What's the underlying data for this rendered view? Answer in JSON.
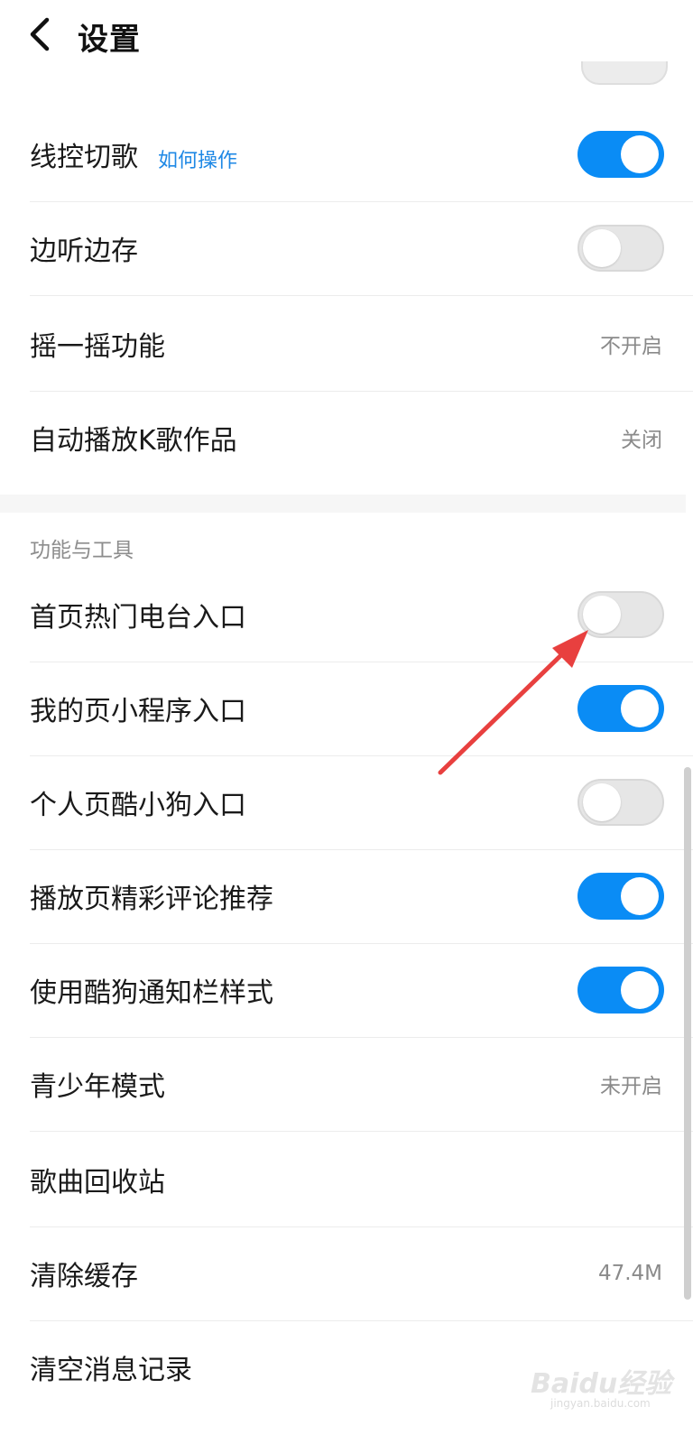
{
  "header": {
    "title": "设置",
    "back_icon": "chevron-left-icon"
  },
  "rows_top": [
    {
      "label": "线控切歌",
      "link": "如何操作",
      "control": "toggle",
      "on": true
    },
    {
      "label": "边听边存",
      "control": "toggle",
      "on": false
    },
    {
      "label": "摇一摇功能",
      "control": "value",
      "value": "不开启"
    },
    {
      "label": "自动播放K歌作品",
      "control": "value",
      "value": "关闭"
    }
  ],
  "section": {
    "title": "功能与工具",
    "rows": [
      {
        "label": "首页热门电台入口",
        "control": "toggle",
        "on": false
      },
      {
        "label": "我的页小程序入口",
        "control": "toggle",
        "on": true
      },
      {
        "label": "个人页酷小狗入口",
        "control": "toggle",
        "on": false
      },
      {
        "label": "播放页精彩评论推荐",
        "control": "toggle",
        "on": true
      },
      {
        "label": "使用酷狗通知栏样式",
        "control": "toggle",
        "on": true
      },
      {
        "label": "青少年模式",
        "control": "value",
        "value": "未开启"
      },
      {
        "label": "歌曲回收站",
        "control": "none"
      },
      {
        "label": "清除缓存",
        "control": "value",
        "value": "47.4M"
      },
      {
        "label": "清空消息记录",
        "control": "none"
      }
    ]
  },
  "colors": {
    "accent": "#0a8cf5",
    "link": "#1e88e5",
    "annotation_arrow": "#e8403f"
  },
  "watermark": {
    "text": "Baidu经验",
    "sub": "jingyan.baidu.com"
  }
}
